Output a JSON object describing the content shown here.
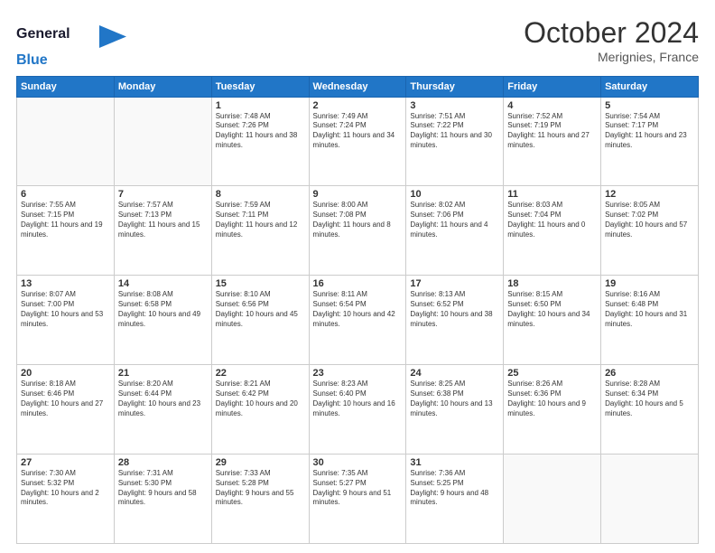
{
  "header": {
    "logo_general": "General",
    "logo_blue": "Blue",
    "month_title": "October 2024",
    "location": "Merignies, France"
  },
  "weekdays": [
    "Sunday",
    "Monday",
    "Tuesday",
    "Wednesday",
    "Thursday",
    "Friday",
    "Saturday"
  ],
  "weeks": [
    [
      {
        "day": "",
        "sunrise": "",
        "sunset": "",
        "daylight": ""
      },
      {
        "day": "",
        "sunrise": "",
        "sunset": "",
        "daylight": ""
      },
      {
        "day": "1",
        "sunrise": "Sunrise: 7:48 AM",
        "sunset": "Sunset: 7:26 PM",
        "daylight": "Daylight: 11 hours and 38 minutes."
      },
      {
        "day": "2",
        "sunrise": "Sunrise: 7:49 AM",
        "sunset": "Sunset: 7:24 PM",
        "daylight": "Daylight: 11 hours and 34 minutes."
      },
      {
        "day": "3",
        "sunrise": "Sunrise: 7:51 AM",
        "sunset": "Sunset: 7:22 PM",
        "daylight": "Daylight: 11 hours and 30 minutes."
      },
      {
        "day": "4",
        "sunrise": "Sunrise: 7:52 AM",
        "sunset": "Sunset: 7:19 PM",
        "daylight": "Daylight: 11 hours and 27 minutes."
      },
      {
        "day": "5",
        "sunrise": "Sunrise: 7:54 AM",
        "sunset": "Sunset: 7:17 PM",
        "daylight": "Daylight: 11 hours and 23 minutes."
      }
    ],
    [
      {
        "day": "6",
        "sunrise": "Sunrise: 7:55 AM",
        "sunset": "Sunset: 7:15 PM",
        "daylight": "Daylight: 11 hours and 19 minutes."
      },
      {
        "day": "7",
        "sunrise": "Sunrise: 7:57 AM",
        "sunset": "Sunset: 7:13 PM",
        "daylight": "Daylight: 11 hours and 15 minutes."
      },
      {
        "day": "8",
        "sunrise": "Sunrise: 7:59 AM",
        "sunset": "Sunset: 7:11 PM",
        "daylight": "Daylight: 11 hours and 12 minutes."
      },
      {
        "day": "9",
        "sunrise": "Sunrise: 8:00 AM",
        "sunset": "Sunset: 7:08 PM",
        "daylight": "Daylight: 11 hours and 8 minutes."
      },
      {
        "day": "10",
        "sunrise": "Sunrise: 8:02 AM",
        "sunset": "Sunset: 7:06 PM",
        "daylight": "Daylight: 11 hours and 4 minutes."
      },
      {
        "day": "11",
        "sunrise": "Sunrise: 8:03 AM",
        "sunset": "Sunset: 7:04 PM",
        "daylight": "Daylight: 11 hours and 0 minutes."
      },
      {
        "day": "12",
        "sunrise": "Sunrise: 8:05 AM",
        "sunset": "Sunset: 7:02 PM",
        "daylight": "Daylight: 10 hours and 57 minutes."
      }
    ],
    [
      {
        "day": "13",
        "sunrise": "Sunrise: 8:07 AM",
        "sunset": "Sunset: 7:00 PM",
        "daylight": "Daylight: 10 hours and 53 minutes."
      },
      {
        "day": "14",
        "sunrise": "Sunrise: 8:08 AM",
        "sunset": "Sunset: 6:58 PM",
        "daylight": "Daylight: 10 hours and 49 minutes."
      },
      {
        "day": "15",
        "sunrise": "Sunrise: 8:10 AM",
        "sunset": "Sunset: 6:56 PM",
        "daylight": "Daylight: 10 hours and 45 minutes."
      },
      {
        "day": "16",
        "sunrise": "Sunrise: 8:11 AM",
        "sunset": "Sunset: 6:54 PM",
        "daylight": "Daylight: 10 hours and 42 minutes."
      },
      {
        "day": "17",
        "sunrise": "Sunrise: 8:13 AM",
        "sunset": "Sunset: 6:52 PM",
        "daylight": "Daylight: 10 hours and 38 minutes."
      },
      {
        "day": "18",
        "sunrise": "Sunrise: 8:15 AM",
        "sunset": "Sunset: 6:50 PM",
        "daylight": "Daylight: 10 hours and 34 minutes."
      },
      {
        "day": "19",
        "sunrise": "Sunrise: 8:16 AM",
        "sunset": "Sunset: 6:48 PM",
        "daylight": "Daylight: 10 hours and 31 minutes."
      }
    ],
    [
      {
        "day": "20",
        "sunrise": "Sunrise: 8:18 AM",
        "sunset": "Sunset: 6:46 PM",
        "daylight": "Daylight: 10 hours and 27 minutes."
      },
      {
        "day": "21",
        "sunrise": "Sunrise: 8:20 AM",
        "sunset": "Sunset: 6:44 PM",
        "daylight": "Daylight: 10 hours and 23 minutes."
      },
      {
        "day": "22",
        "sunrise": "Sunrise: 8:21 AM",
        "sunset": "Sunset: 6:42 PM",
        "daylight": "Daylight: 10 hours and 20 minutes."
      },
      {
        "day": "23",
        "sunrise": "Sunrise: 8:23 AM",
        "sunset": "Sunset: 6:40 PM",
        "daylight": "Daylight: 10 hours and 16 minutes."
      },
      {
        "day": "24",
        "sunrise": "Sunrise: 8:25 AM",
        "sunset": "Sunset: 6:38 PM",
        "daylight": "Daylight: 10 hours and 13 minutes."
      },
      {
        "day": "25",
        "sunrise": "Sunrise: 8:26 AM",
        "sunset": "Sunset: 6:36 PM",
        "daylight": "Daylight: 10 hours and 9 minutes."
      },
      {
        "day": "26",
        "sunrise": "Sunrise: 8:28 AM",
        "sunset": "Sunset: 6:34 PM",
        "daylight": "Daylight: 10 hours and 5 minutes."
      }
    ],
    [
      {
        "day": "27",
        "sunrise": "Sunrise: 7:30 AM",
        "sunset": "Sunset: 5:32 PM",
        "daylight": "Daylight: 10 hours and 2 minutes."
      },
      {
        "day": "28",
        "sunrise": "Sunrise: 7:31 AM",
        "sunset": "Sunset: 5:30 PM",
        "daylight": "Daylight: 9 hours and 58 minutes."
      },
      {
        "day": "29",
        "sunrise": "Sunrise: 7:33 AM",
        "sunset": "Sunset: 5:28 PM",
        "daylight": "Daylight: 9 hours and 55 minutes."
      },
      {
        "day": "30",
        "sunrise": "Sunrise: 7:35 AM",
        "sunset": "Sunset: 5:27 PM",
        "daylight": "Daylight: 9 hours and 51 minutes."
      },
      {
        "day": "31",
        "sunrise": "Sunrise: 7:36 AM",
        "sunset": "Sunset: 5:25 PM",
        "daylight": "Daylight: 9 hours and 48 minutes."
      },
      {
        "day": "",
        "sunrise": "",
        "sunset": "",
        "daylight": ""
      },
      {
        "day": "",
        "sunrise": "",
        "sunset": "",
        "daylight": ""
      }
    ]
  ]
}
